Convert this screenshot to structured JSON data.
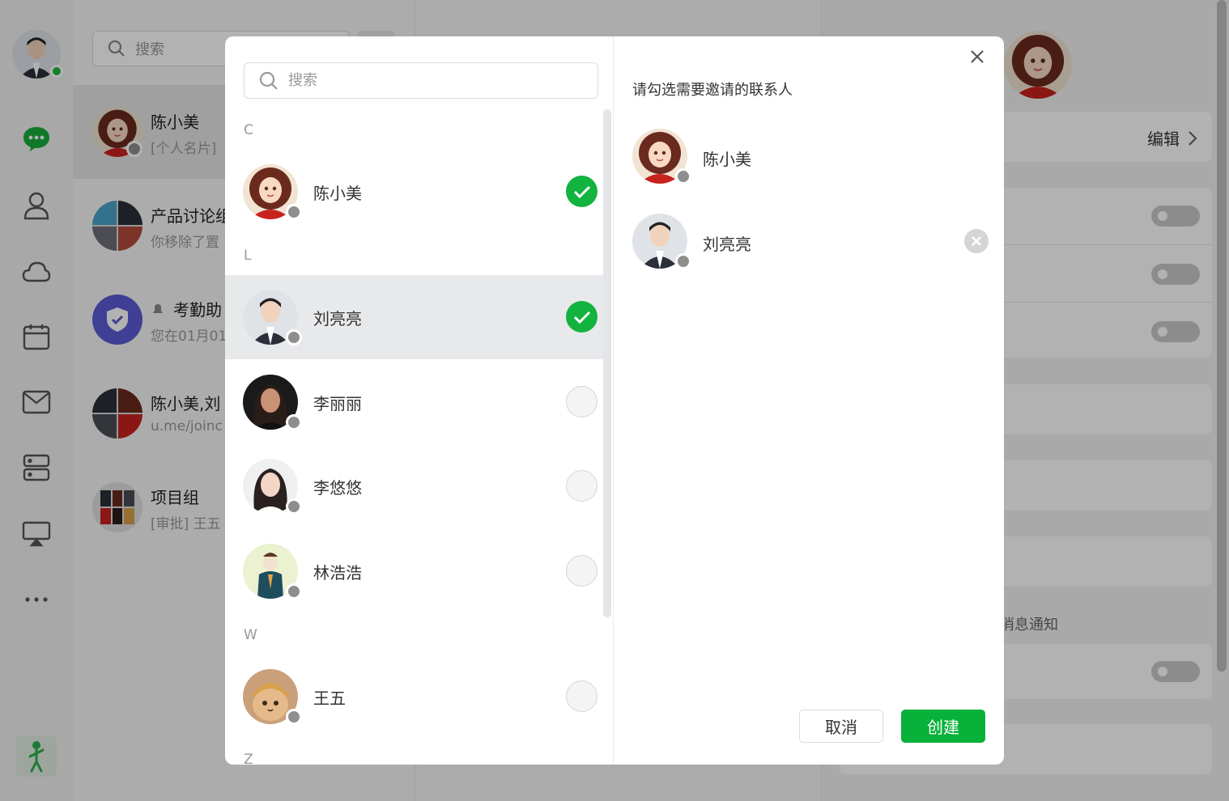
{
  "nav": {
    "status_color": "#1fb83b",
    "icons": [
      "chat-icon",
      "contacts-icon",
      "cloud-icon",
      "calendar-icon",
      "mail-icon",
      "storage-icon",
      "screen-share-icon",
      "more-icon"
    ]
  },
  "conversations": {
    "search_placeholder": "搜索",
    "items": [
      {
        "name": "陈小美",
        "sub": "[个人名片]",
        "active": true
      },
      {
        "name": "产品讨论组",
        "sub": "你移除了置"
      },
      {
        "name": "考勤助",
        "sub": "您在01月01"
      },
      {
        "name": "陈小美,刘",
        "sub": "u.me/joinc"
      },
      {
        "name": "项目组",
        "sub": "[审批] 王五"
      }
    ]
  },
  "detail": {
    "edit_label": "编辑",
    "notify_label": "消息通知"
  },
  "modal": {
    "search_placeholder": "搜索",
    "hint": "请勾选需要邀请的联系人",
    "letters": [
      "C",
      "L",
      "W",
      "Z"
    ],
    "contacts": [
      {
        "name": "陈小美",
        "checked": true
      },
      {
        "name": "刘亮亮",
        "checked": true
      },
      {
        "name": "李丽丽",
        "checked": false
      },
      {
        "name": "李悠悠",
        "checked": false
      },
      {
        "name": "林浩浩",
        "checked": false
      },
      {
        "name": "王五",
        "checked": false
      }
    ],
    "selected": [
      {
        "name": "陈小美"
      },
      {
        "name": "刘亮亮"
      }
    ],
    "cancel_label": "取消",
    "create_label": "创建",
    "accent_color": "#08b13a"
  }
}
